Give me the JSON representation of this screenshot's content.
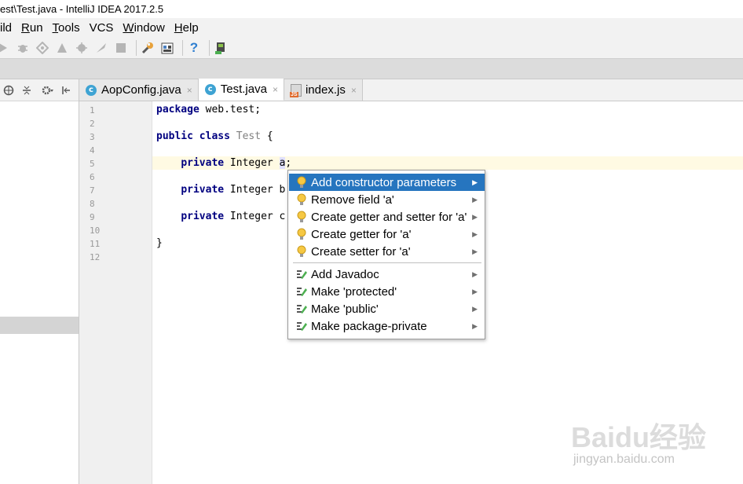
{
  "window": {
    "title": "est\\Test.java - IntelliJ IDEA 2017.2.5"
  },
  "menu": [
    {
      "label": "ild",
      "underline": ""
    },
    {
      "label": "Run",
      "underline": "R"
    },
    {
      "label": "Tools",
      "underline": "T"
    },
    {
      "label": "VCS",
      "underline": ""
    },
    {
      "label": "Window",
      "underline": "W"
    },
    {
      "label": "Help",
      "underline": "H"
    }
  ],
  "menu_labels": {
    "m0": "ild",
    "m1_rest": "un",
    "m2_rest": "ools",
    "m3": "VCS",
    "m4_rest": "indow",
    "m5_rest": "elp",
    "m1_u": "R",
    "m2_u": "T",
    "m4_u": "W",
    "m5_u": "H"
  },
  "toolbar": {
    "icons": [
      "run-icon",
      "debug-icon",
      "coverage-icon",
      "profile-icon",
      "attach-icon",
      "build-icon",
      "stop-icon",
      "project-structure-icon",
      "sdk-icon",
      "help-icon",
      "sdk-manager-icon"
    ],
    "help_glyph": "?"
  },
  "tabs": [
    {
      "label": "AopConfig.java",
      "icon": "java-class-icon",
      "icon_glyph": "c",
      "close": "×"
    },
    {
      "label": "Test.java",
      "icon": "java-class-icon",
      "icon_glyph": "c",
      "close": "×"
    },
    {
      "label": "index.js",
      "icon": "javascript-file-icon",
      "icon_glyph": "JS",
      "close": "×"
    }
  ],
  "gutter": {
    "line_numbers": [
      "1",
      "2",
      "3",
      "4",
      "5",
      "6",
      "7",
      "8",
      "9",
      "10",
      "11",
      "12"
    ]
  },
  "code": {
    "l1_kw": "package",
    "l1_rest": " web.test;",
    "l3_kw1": "public",
    "l3_kw2": "class",
    "l3_name": "Test",
    "l3_brace": " {",
    "l5_kw": "private",
    "l5_type": " Integer ",
    "l5_var": "a",
    "l5_end": ";",
    "l7_kw": "private",
    "l7_rest": " Integer b",
    "l9_kw": "private",
    "l9_rest": " Integer c",
    "l11": "}"
  },
  "intention_popup": {
    "items": [
      {
        "label": "Add constructor parameters",
        "icon": "lightbulb-icon",
        "arrow": "▶"
      },
      {
        "label": "Remove field 'a'",
        "icon": "lightbulb-icon",
        "arrow": "▶"
      },
      {
        "label": "Create getter and setter for 'a'",
        "icon": "lightbulb-icon",
        "arrow": "▶"
      },
      {
        "label": "Create getter for 'a'",
        "icon": "lightbulb-icon",
        "arrow": "▶"
      },
      {
        "label": "Create setter for 'a'",
        "icon": "lightbulb-icon",
        "arrow": "▶"
      },
      {
        "label": "Add Javadoc",
        "icon": "intention-pencil-icon",
        "arrow": "▶"
      },
      {
        "label": "Make 'protected'",
        "icon": "intention-pencil-icon",
        "arrow": "▶"
      },
      {
        "label": "Make 'public'",
        "icon": "intention-pencil-icon",
        "arrow": "▶"
      },
      {
        "label": "Make package-private",
        "icon": "intention-pencil-icon",
        "arrow": "▶"
      }
    ],
    "selected_index": 0
  },
  "watermark": {
    "logo": "Baidu经验",
    "url": "jingyan.baidu.com"
  },
  "colors": {
    "selection": "#2675bf",
    "keyword": "#000080",
    "current_line": "#fffae3"
  }
}
